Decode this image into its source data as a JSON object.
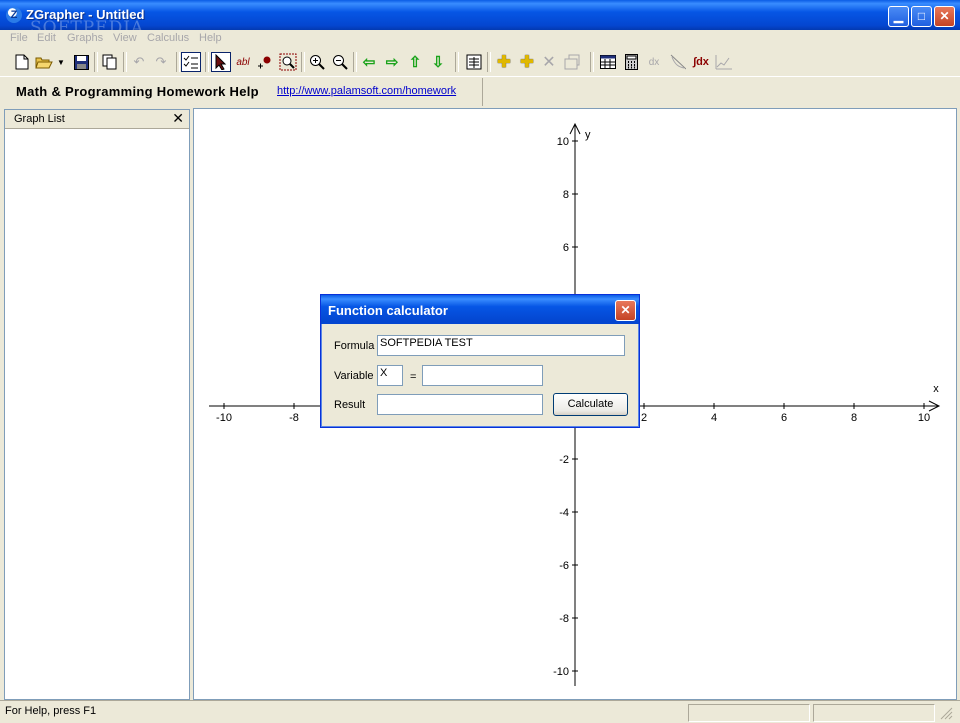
{
  "window": {
    "title": "ZGrapher - Untitled",
    "app_icon": "Z",
    "watermark": "SOFTPEDIA"
  },
  "window_controls": {
    "minimize": "▁",
    "maximize": "□",
    "close": "✕"
  },
  "menu": [
    "File",
    "Edit",
    "Graphs",
    "View",
    "Calculus",
    "Help"
  ],
  "toolbar_icons": [
    "new-file-icon",
    "open-folder-icon",
    "save-icon",
    "copy-icon",
    "undo-icon",
    "redo-icon",
    "graph-list-icon",
    "pointer-icon",
    "text-label-icon",
    "point-icon",
    "zoom-box-icon",
    "zoom-in-icon",
    "zoom-out-icon",
    "arrow-left-icon",
    "arrow-right-icon",
    "arrow-up-icon",
    "arrow-down-icon",
    "function-table-icon",
    "add-graph-icon",
    "edit-graph-icon",
    "delete-graph-icon",
    "graph-properties-icon",
    "table-icon",
    "calculator-icon",
    "derivative-icon",
    "tangent-icon",
    "integral-icon",
    "plot-icon"
  ],
  "toolbar_text": {
    "text_label": "abl",
    "derivative": "dx",
    "integral": "∫dx"
  },
  "promo": {
    "title": "Math & Programming Homework Help",
    "link": "http://www.palamsoft.com/homework"
  },
  "graph_list": {
    "title": "Graph List",
    "close": "✕"
  },
  "graph": {
    "x_label": "x",
    "y_label": "y",
    "x_ticks": [
      "-10",
      "-8",
      "2",
      "4",
      "6",
      "8",
      "10"
    ],
    "y_ticks": [
      "10",
      "8",
      "6",
      "-2",
      "-4",
      "-6",
      "-8",
      "-10"
    ]
  },
  "dialog": {
    "title": "Function calculator",
    "close": "✕",
    "formula_label": "Formula",
    "formula_value": "SOFTPEDIA TEST",
    "variable_label": "Variable",
    "variable_value": "X",
    "equals": "=",
    "variable_input_value": "",
    "result_label": "Result",
    "result_value": "",
    "calculate_button": "Calculate"
  },
  "status": {
    "text": "For Help, press F1"
  }
}
